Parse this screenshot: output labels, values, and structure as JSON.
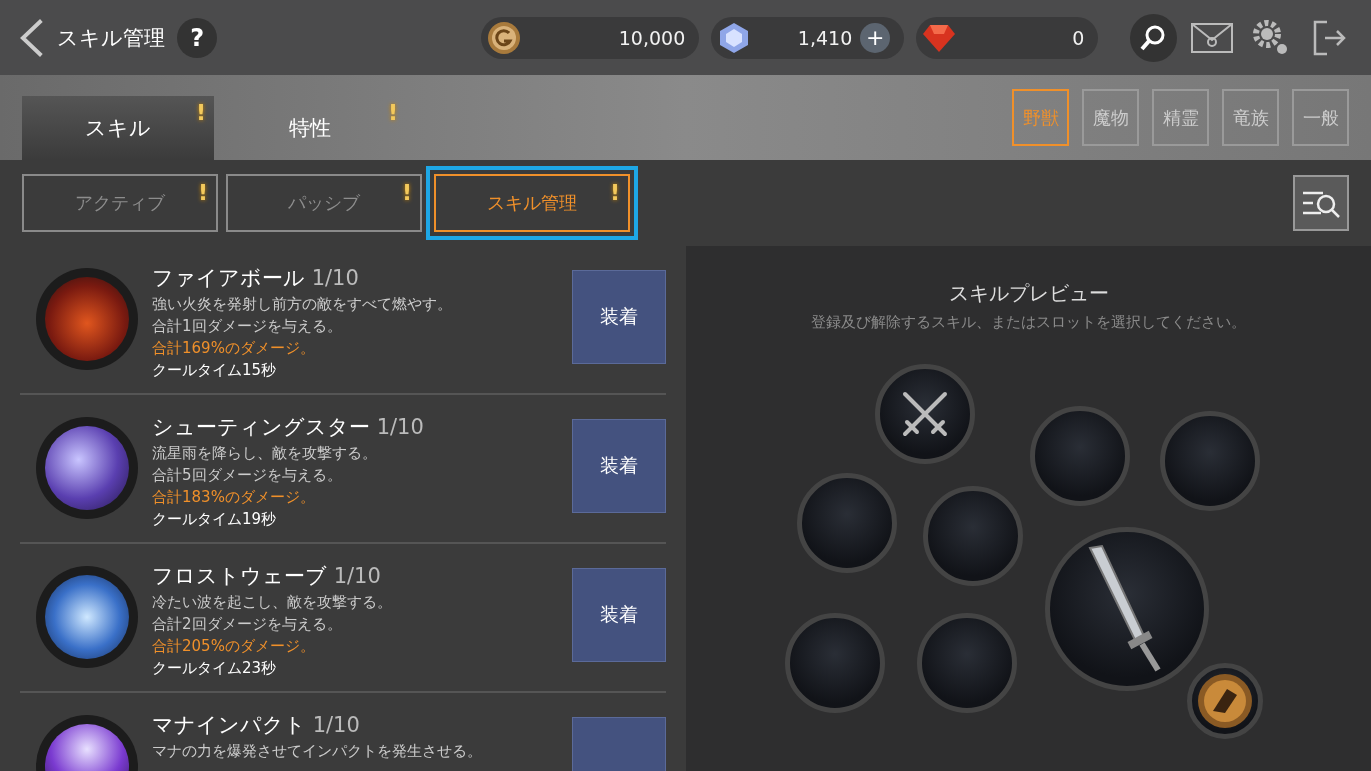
{
  "header": {
    "title": "スキル管理",
    "help": "?",
    "currencies": [
      {
        "kind": "gold",
        "amount": "10,000",
        "addable": false
      },
      {
        "kind": "crystal",
        "amount": "1,410",
        "addable": true,
        "add_label": "+"
      },
      {
        "kind": "ruby",
        "amount": "0",
        "addable": false
      }
    ]
  },
  "main_tabs": [
    {
      "label": "スキル",
      "selected": true,
      "badge": "!"
    },
    {
      "label": "特性",
      "selected": false,
      "badge": "!"
    }
  ],
  "categories": [
    {
      "label": "野獣",
      "selected": true
    },
    {
      "label": "魔物",
      "selected": false
    },
    {
      "label": "精霊",
      "selected": false
    },
    {
      "label": "竜族",
      "selected": false
    },
    {
      "label": "一般",
      "selected": false
    }
  ],
  "sub_tabs": [
    {
      "label": "アクティブ",
      "selected": false,
      "badge": "!"
    },
    {
      "label": "パッシブ",
      "selected": false,
      "badge": "!"
    },
    {
      "label": "スキル管理",
      "selected": true,
      "badge": "!"
    }
  ],
  "skills": [
    {
      "name": "ファイアボール",
      "level": "1/10",
      "lines": [
        "強い火炎を発射し前方の敵をすべて燃やす。",
        "合計1回ダメージを与える。"
      ],
      "damage": "合計169%のダメージ。",
      "cooldown": "クールタイム15秒",
      "button": "装着"
    },
    {
      "name": "シューティングスター",
      "level": "1/10",
      "lines": [
        "流星雨を降らし、敵を攻撃する。",
        "合計5回ダメージを与える。"
      ],
      "damage": "合計183%のダメージ。",
      "cooldown": "クールタイム19秒",
      "button": "装着"
    },
    {
      "name": "フロストウェーブ",
      "level": "1/10",
      "lines": [
        "冷たい波を起こし、敵を攻撃する。",
        "合計2回ダメージを与える。"
      ],
      "damage": "合計205%のダメージ。",
      "cooldown": "クールタイム23秒",
      "button": "装着"
    },
    {
      "name": "マナインパクト",
      "level": "1/10",
      "lines": [
        "マナの力を爆発させてインパクトを発生させる。"
      ]
    }
  ],
  "preview": {
    "title": "スキルプレビュー",
    "hint": "登録及び解除するスキル、またはスロットを選択してください。",
    "slots": [
      {
        "kind": "swords"
      },
      {
        "kind": "empty"
      },
      {
        "kind": "empty"
      },
      {
        "kind": "empty"
      },
      {
        "kind": "empty"
      },
      {
        "kind": "weapon"
      },
      {
        "kind": "empty"
      },
      {
        "kind": "empty"
      },
      {
        "kind": "emblem"
      }
    ]
  }
}
